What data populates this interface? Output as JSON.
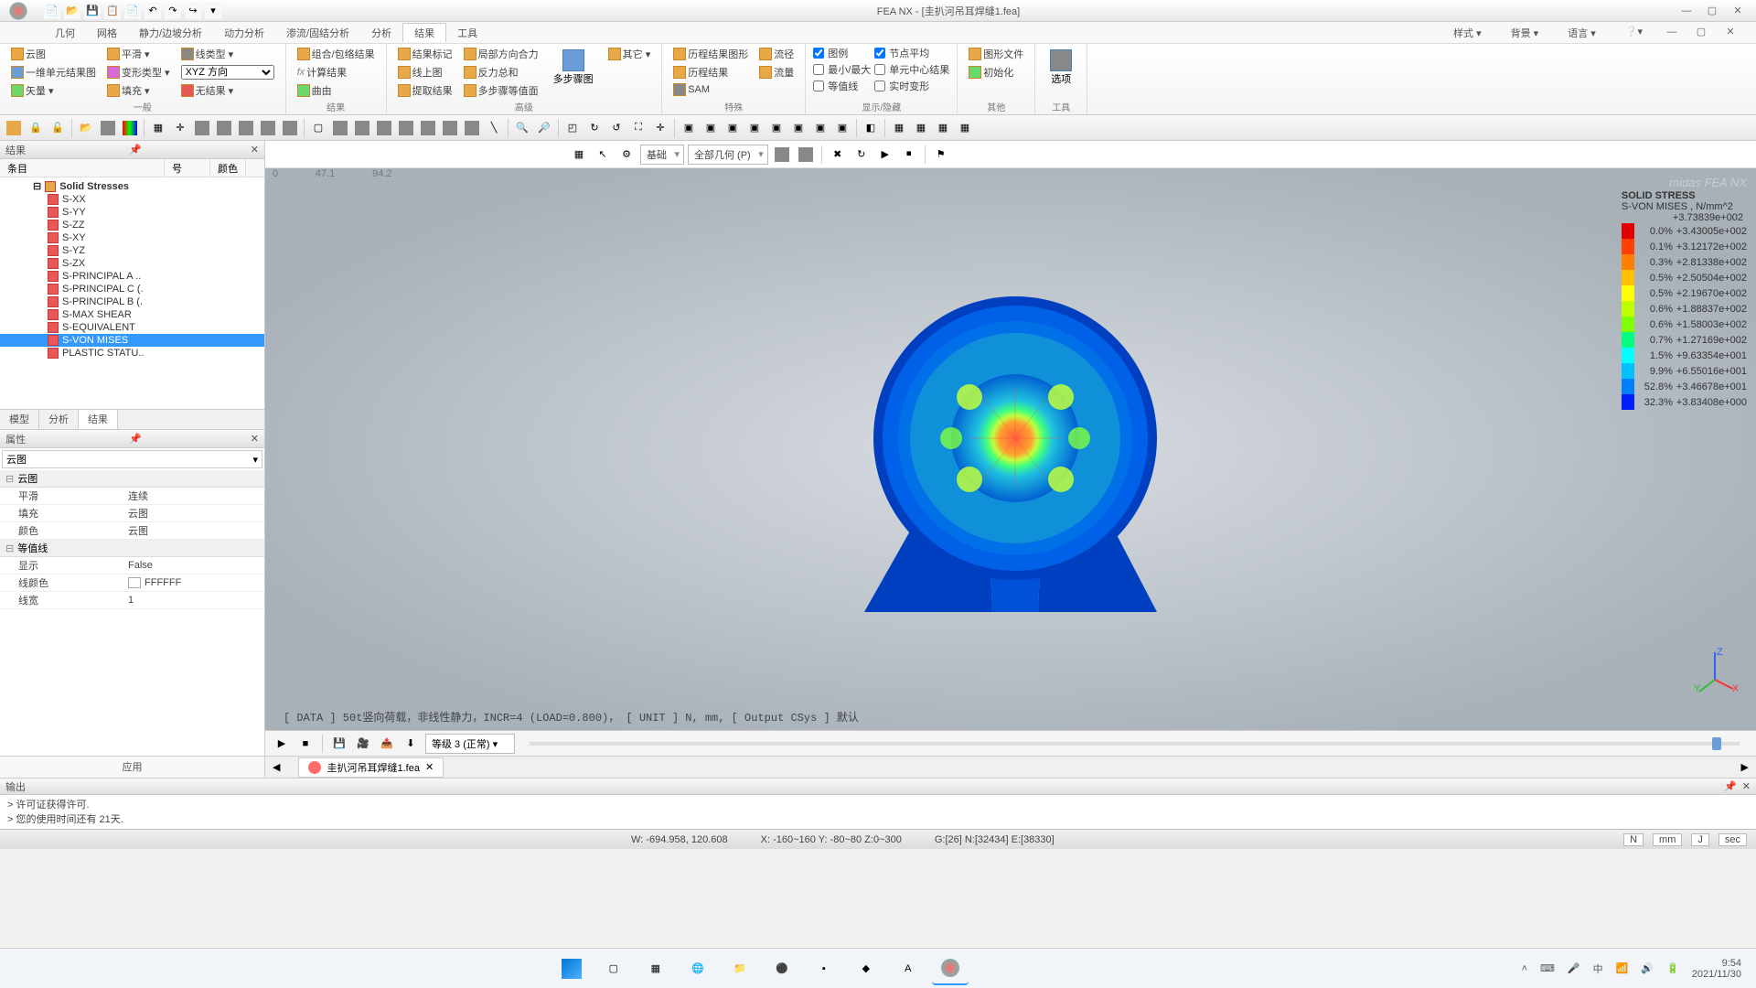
{
  "app": {
    "title": "FEA NX - [圭扒河吊耳焊缝1.fea]",
    "watermark": "midas FEA NX"
  },
  "menu": {
    "items": [
      "几何",
      "网格",
      "静力/边坡分析",
      "动力分析",
      "渗流/固结分析",
      "分析",
      "结果",
      "工具"
    ],
    "active_index": 6,
    "right": [
      "样式 ▾",
      "背景 ▾",
      "语言 ▾"
    ]
  },
  "ribbon": {
    "g1": {
      "label": "一般",
      "items": {
        "contour": "云图",
        "elem_result": "一维单元结果图",
        "vector": "矢量 ▾",
        "smooth": "平滑 ▾",
        "deform": "变形类型 ▾",
        "fill": "填充 ▾",
        "dir_select": "XYZ 方向",
        "wire_type": "线类型 ▾",
        "no_result": "无结果 ▾"
      }
    },
    "g2": {
      "label": "结果",
      "combine": "组合/包络结果",
      "calc": "计算结果",
      "curve": "曲由"
    },
    "g3": {
      "label": "高级",
      "result_mark": "结果标记",
      "line_plot": "线上图",
      "extract": "提取结果",
      "local_force": "局部方向合力",
      "react_sum": "反力总和",
      "multi_iso": "多步骤等值面",
      "multi_step": "多步骤图",
      "other": "其它 ▾"
    },
    "g4": {
      "label": "特殊",
      "history": "历程结果图形",
      "time_result": "历程结果",
      "sam": "SAM",
      "path": "流径",
      "volume": "流量"
    },
    "g5": {
      "label": "显示/隐藏",
      "legend": "图例",
      "minmax": "最小/最大",
      "iso": "等值线",
      "node_avg": "节点平均",
      "elem_center": "单元中心结果",
      "real_deform": "实时变形"
    },
    "g6": {
      "label": "其他",
      "image": "图形文件",
      "init": "初始化"
    },
    "g7": {
      "label": "工具",
      "options": "选项"
    }
  },
  "left": {
    "panel_title": "结果",
    "columns": [
      "条目",
      "号",
      "颜色"
    ],
    "tree_parent": "Solid Stresses",
    "tree_items": [
      "S-XX",
      "S-YY",
      "S-ZZ",
      "S-XY",
      "S-YZ",
      "S-ZX",
      "S-PRINCIPAL A ..",
      "S-PRINCIPAL C (.",
      "S-PRINCIPAL B (.",
      "S-MAX SHEAR",
      "S-EQUIVALENT",
      "S-VON MISES",
      "PLASTIC STATU.."
    ],
    "selected_index": 11,
    "tabs": [
      "模型",
      "分析",
      "结果"
    ],
    "active_tab": 2
  },
  "props": {
    "panel_title": "属性",
    "dropdown": "云图",
    "section1": "云图",
    "section2": "等值线",
    "rows": [
      {
        "k": "平滑",
        "v": "连续"
      },
      {
        "k": "填充",
        "v": "云图"
      },
      {
        "k": "颜色",
        "v": "云图"
      }
    ],
    "rows2": [
      {
        "k": "显示",
        "v": "False"
      },
      {
        "k": "线颜色",
        "v": "FFFFFF",
        "color": true
      },
      {
        "k": "线宽",
        "v": "1"
      }
    ],
    "apply": "应用"
  },
  "viewport": {
    "vp_selects": [
      "基础",
      "全部几何 (P)"
    ],
    "ruler": [
      "0",
      "47.1",
      "94.2"
    ],
    "info": "[ DATA ]  50t竖向荷载，非线性静力，INCR=4 (LOAD=0.800)，  [ UNIT ]   N,  mm,   [ Output CSys ]  默认"
  },
  "legend": {
    "title1": "SOLID STRESS",
    "title2": "S-VON MISES , N/mm^2",
    "max": "+3.73839e+002",
    "rows": [
      {
        "pct": "0.0%",
        "val": "+3.43005e+002",
        "c": "#e00000"
      },
      {
        "pct": "0.1%",
        "val": "+3.12172e+002",
        "c": "#ff4000"
      },
      {
        "pct": "0.3%",
        "val": "+2.81338e+002",
        "c": "#ff8000"
      },
      {
        "pct": "0.5%",
        "val": "+2.50504e+002",
        "c": "#ffc000"
      },
      {
        "pct": "0.5%",
        "val": "+2.19670e+002",
        "c": "#ffff00"
      },
      {
        "pct": "0.6%",
        "val": "+1.88837e+002",
        "c": "#c0ff00"
      },
      {
        "pct": "0.6%",
        "val": "+1.58003e+002",
        "c": "#80ff00"
      },
      {
        "pct": "0.7%",
        "val": "+1.27169e+002",
        "c": "#00ff80"
      },
      {
        "pct": "1.5%",
        "val": "+9.63354e+001",
        "c": "#00ffff"
      },
      {
        "pct": "9.9%",
        "val": "+6.55016e+001",
        "c": "#00c0ff"
      },
      {
        "pct": "52.8%",
        "val": "+3.46678e+001",
        "c": "#0080ff"
      },
      {
        "pct": "32.3%",
        "val": "+3.83408e+000",
        "c": "#0020ff"
      }
    ]
  },
  "playbar": {
    "select": "等级 3 (正常)"
  },
  "doctab": "圭扒河吊耳焊缝1.fea",
  "output": {
    "title": "输出",
    "lines": [
      "> 许可证获得许可.",
      "> 您的使用时间还有 21天."
    ]
  },
  "status": {
    "w": "W: -694.958, 120.608",
    "xyz": "X: -160~160 Y: -80~80 Z:0~300",
    "gne": "G:[26] N:[32434] E:[38330]",
    "units": [
      "N",
      "mm",
      "J",
      "sec"
    ]
  },
  "clock": {
    "time": "9:54",
    "date": "2021/11/30"
  }
}
